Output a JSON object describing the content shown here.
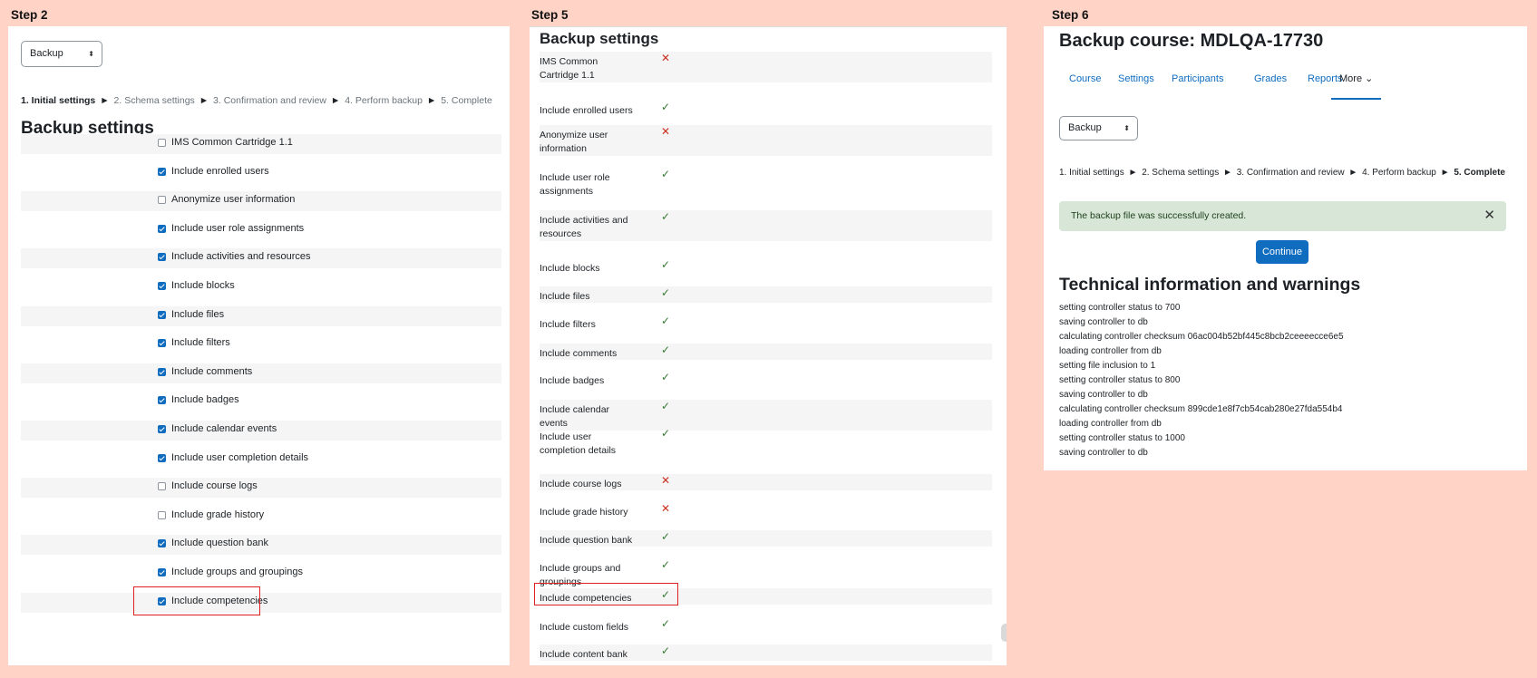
{
  "steps": {
    "step2": "Step 2",
    "step5": "Step 5",
    "step6": "Step 6"
  },
  "panel1": {
    "select_value": "Backup",
    "breadcrumb": [
      {
        "label": "1. Initial settings",
        "current": true
      },
      {
        "label": "2. Schema settings",
        "current": false
      },
      {
        "label": "3. Confirmation and review",
        "current": false
      },
      {
        "label": "4. Perform backup",
        "current": false
      },
      {
        "label": "5. Complete",
        "current": false
      }
    ],
    "separator": "►",
    "heading": "Backup settings",
    "settings": [
      {
        "label": "IMS Common Cartridge 1.1",
        "checked": false
      },
      {
        "label": "Include enrolled users",
        "checked": true
      },
      {
        "label": "Anonymize user information",
        "checked": false
      },
      {
        "label": "Include user role assignments",
        "checked": true
      },
      {
        "label": "Include activities and resources",
        "checked": true
      },
      {
        "label": "Include blocks",
        "checked": true
      },
      {
        "label": "Include files",
        "checked": true
      },
      {
        "label": "Include filters",
        "checked": true
      },
      {
        "label": "Include comments",
        "checked": true
      },
      {
        "label": "Include badges",
        "checked": true
      },
      {
        "label": "Include calendar events",
        "checked": true
      },
      {
        "label": "Include user completion details",
        "checked": true
      },
      {
        "label": "Include course logs",
        "checked": false
      },
      {
        "label": "Include grade history",
        "checked": false
      },
      {
        "label": "Include question bank",
        "checked": true
      },
      {
        "label": "Include groups and groupings",
        "checked": true
      },
      {
        "label": "Include competencies",
        "checked": true,
        "highlighted": true
      }
    ]
  },
  "panel2": {
    "heading": "Backup settings",
    "check_glyph": "✓",
    "cross_glyph": "✕",
    "settings": [
      {
        "label": "IMS Common Cartridge 1.1",
        "enabled": false
      },
      {
        "label": "Include enrolled users",
        "enabled": true
      },
      {
        "label": "Anonymize user information",
        "enabled": false
      },
      {
        "label": "Include user role assignments",
        "enabled": true
      },
      {
        "label": "Include activities and resources",
        "enabled": true
      },
      {
        "label": "Include blocks",
        "enabled": true
      },
      {
        "label": "Include files",
        "enabled": true
      },
      {
        "label": "Include filters",
        "enabled": true
      },
      {
        "label": "Include comments",
        "enabled": true
      },
      {
        "label": "Include badges",
        "enabled": true
      },
      {
        "label": "Include calendar events",
        "enabled": true
      },
      {
        "label": "Include user completion details",
        "enabled": true
      },
      {
        "label": "Include course logs",
        "enabled": false
      },
      {
        "label": "Include grade history",
        "enabled": false
      },
      {
        "label": "Include question bank",
        "enabled": true
      },
      {
        "label": "Include groups and groupings",
        "enabled": true
      },
      {
        "label": "Include competencies",
        "enabled": true,
        "highlighted": true
      },
      {
        "label": "Include custom fields",
        "enabled": true
      },
      {
        "label": "Include content bank",
        "enabled": true
      }
    ]
  },
  "panel3": {
    "title": "Backup course: MDLQA-17730",
    "nav": [
      "Course",
      "Settings",
      "Participants",
      "Grades",
      "Reports",
      "More"
    ],
    "more_chevron": "⌄",
    "select_value": "Backup",
    "breadcrumb": [
      {
        "label": "1. Initial settings",
        "current": false
      },
      {
        "label": "2. Schema settings",
        "current": false
      },
      {
        "label": "3. Confirmation and review",
        "current": false
      },
      {
        "label": "4. Perform backup",
        "current": false
      },
      {
        "label": "5. Complete",
        "current": true
      }
    ],
    "separator": "►",
    "alert": "The backup file was successfully created.",
    "alert_close": "✕",
    "continue_button": "Continue",
    "tech_heading": "Technical information and warnings",
    "log": [
      "setting controller status to 700",
      "saving controller to db",
      "calculating controller checksum 06ac004b52bf445c8bcb2ceeeecce6e5",
      "loading controller from db",
      "setting file inclusion to 1",
      "setting controller status to 800",
      "saving controller to db",
      "calculating controller checksum 899cde1e8f7cb54cab280e27fda554b4",
      "loading controller from db",
      "setting controller status to 1000",
      "saving controller to db"
    ]
  },
  "colors": {
    "background": "#ffd4c6",
    "accent": "#0f6cbf",
    "success": "#357a32",
    "error": "#ca3120",
    "highlight": "#e02020"
  }
}
